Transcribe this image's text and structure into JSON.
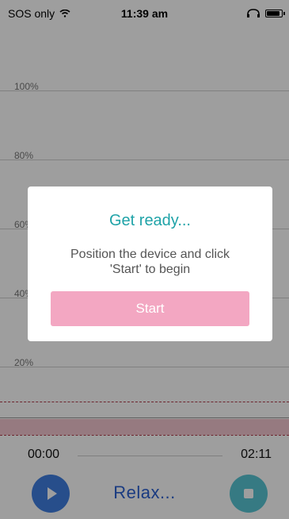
{
  "statusbar": {
    "carrier": "SOS only",
    "time": "11:39 am"
  },
  "chart": {
    "labels": [
      "100%",
      "80%",
      "60%",
      "40%",
      "20%"
    ]
  },
  "timeline": {
    "start": "00:00",
    "end": "02:11"
  },
  "controls": {
    "label": "Relax...",
    "play_icon": "play-icon",
    "stop_icon": "stop-icon"
  },
  "dialog": {
    "title": "Get ready...",
    "message": "Position the device and click\n'Start' to begin",
    "start_label": "Start"
  },
  "colors": {
    "accent_teal": "#1fa3a8",
    "start_pink": "#f3a7c2",
    "play_blue": "#3f7fe0",
    "stop_teal": "#57c6d4"
  }
}
